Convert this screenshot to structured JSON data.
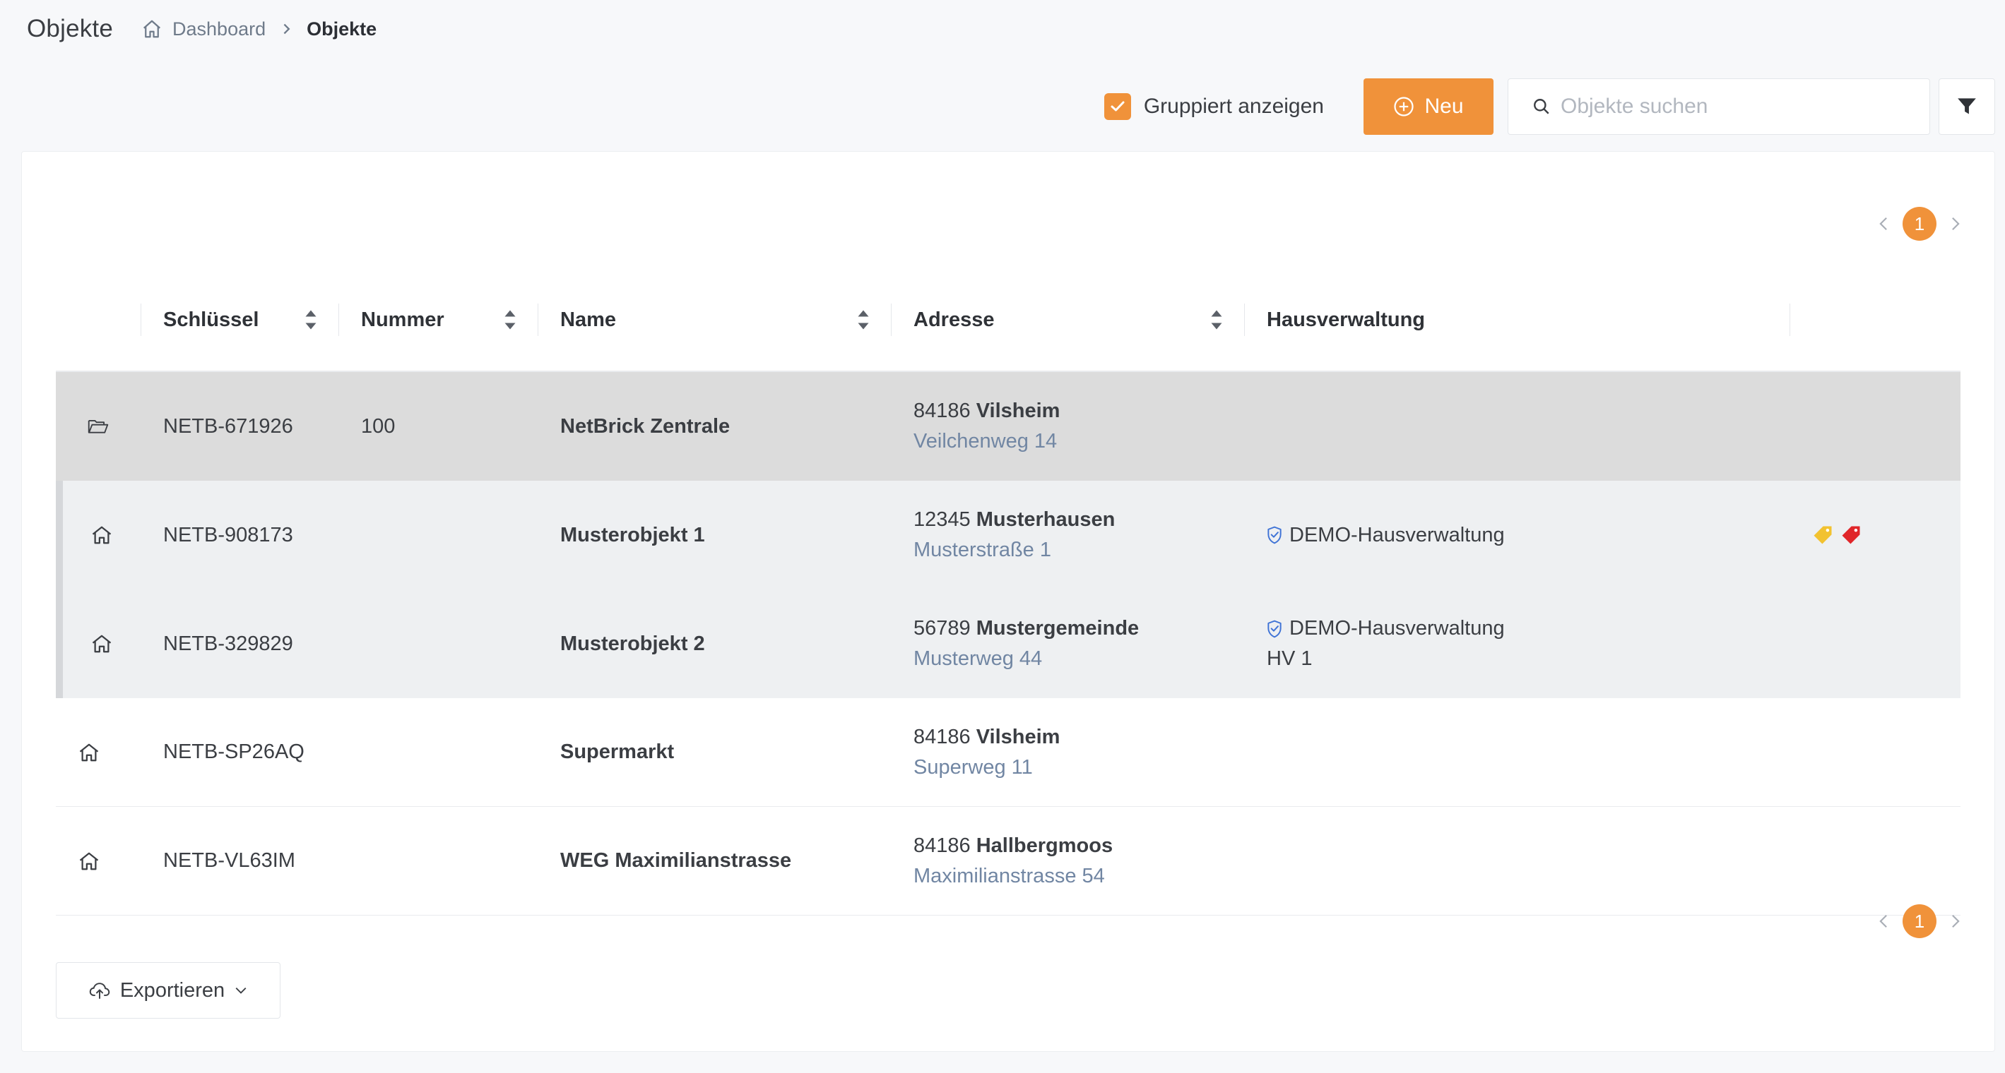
{
  "header": {
    "title": "Objekte",
    "breadcrumb": {
      "home_label": "Dashboard",
      "current_label": "Objekte"
    }
  },
  "toolbar": {
    "group_checkbox_label": "Gruppiert anzeigen",
    "group_checked": true,
    "new_button_label": "Neu",
    "search_placeholder": "Objekte suchen",
    "search_value": ""
  },
  "pagination": {
    "current_page": "1"
  },
  "table": {
    "columns": {
      "key": "Schlüssel",
      "number": "Nummer",
      "name": "Name",
      "address": "Adresse",
      "management": "Hausverwaltung"
    },
    "rows": [
      {
        "type": "group",
        "icon": "folder-open-icon",
        "key": "NETB-671926",
        "number": "100",
        "name": "NetBrick Zentrale",
        "zip": "84186",
        "city": "Vilsheim",
        "street": "Veilchenweg 14",
        "management": "",
        "management_sub": ""
      },
      {
        "type": "child",
        "icon": "home-icon",
        "key": "NETB-908173",
        "number": "",
        "name": "Musterobjekt 1",
        "zip": "12345",
        "city": "Musterhausen",
        "street": "Musterstraße 1",
        "management": "DEMO-Hausverwaltung",
        "management_sub": "",
        "tags": [
          "yellow",
          "red"
        ]
      },
      {
        "type": "child",
        "icon": "home-icon",
        "key": "NETB-329829",
        "number": "",
        "name": "Musterobjekt 2",
        "zip": "56789",
        "city": "Mustergemeinde",
        "street": "Musterweg 44",
        "management": "DEMO-Hausverwaltung",
        "management_sub": "HV 1"
      },
      {
        "type": "normal",
        "icon": "home-icon",
        "key": "NETB-SP26AQ",
        "number": "",
        "name": "Supermarkt",
        "zip": "84186",
        "city": "Vilsheim",
        "street": "Superweg 11",
        "management": "",
        "management_sub": ""
      },
      {
        "type": "normal",
        "icon": "home-icon",
        "key": "NETB-VL63IM",
        "number": "",
        "name": "WEG Maximilianstrasse",
        "zip": "84186",
        "city": "Hallbergmoos",
        "street": "Maximilianstrasse 54",
        "management": "",
        "management_sub": ""
      }
    ]
  },
  "footer": {
    "export_label": "Exportieren"
  },
  "colors": {
    "accent": "#f0923a",
    "address_street": "#7186a3",
    "group_row_bg": "#dcdcdc",
    "child_row_bg": "#eef0f2",
    "tag_yellow": "#f2c230",
    "tag_red": "#e0262a",
    "shield_blue": "#3f73d6"
  }
}
